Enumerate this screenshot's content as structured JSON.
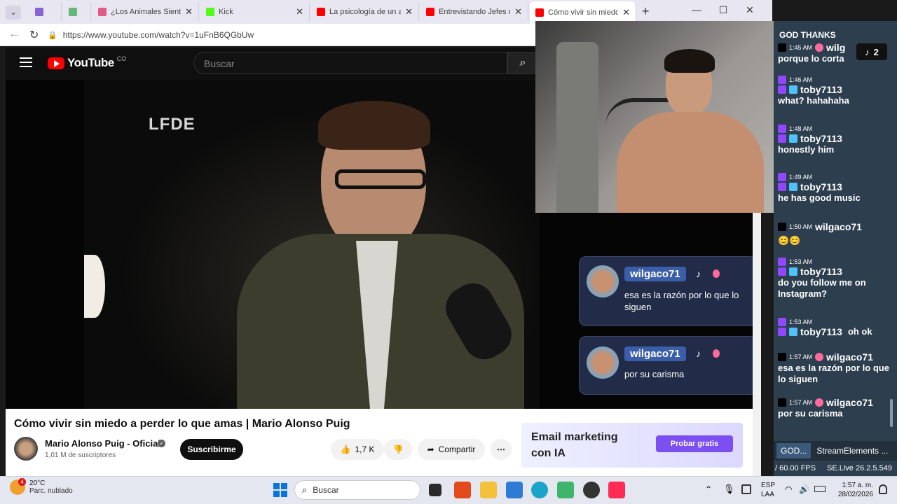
{
  "browser": {
    "tabs": [
      {
        "label": "",
        "color": "#8a63d2"
      },
      {
        "label": "",
        "color": "#64b97a"
      },
      {
        "label": "¿Los Animales Sienten A",
        "color": "#e05a86"
      },
      {
        "label": "Kick",
        "color": "#53fc18"
      },
      {
        "label": "La psicología de un adic",
        "color": "#ff0000"
      },
      {
        "label": "Entrevistando Jefes de N",
        "color": "#ff0000"
      },
      {
        "label": "Cómo vivir sin miedo a p",
        "color": "#ff0000"
      }
    ],
    "url": "https://www.youtube.com/watch?v=1uFnB6QGbUw"
  },
  "youtube": {
    "logo": "YouTube",
    "country": "CO",
    "search_placeholder": "Buscar",
    "video_watermark": "LFDE",
    "title": "Cómo vivir sin miedo a perder lo que amas | Mario Alonso Puig",
    "channel": "Mario Alonso Puig - Oficial",
    "subscribers": "1,01 M de suscriptores",
    "subscribe": "Suscribirme",
    "likes": "1,7 K",
    "share": "Compartir",
    "ad_title_1": "Email marketing",
    "ad_title_2": "con IA",
    "ad_cta": "Probar gratis"
  },
  "overlays": [
    {
      "user": "wilgaco71",
      "text": "esa es la razón por lo que lo siguen"
    },
    {
      "user": "wilgaco71",
      "text": "por su carisma"
    }
  ],
  "chat": {
    "header": "GOD THANKS",
    "tiktok_count": "2",
    "messages": [
      {
        "time": "1:45 AM",
        "user": "wilg",
        "platform": "tiktok",
        "text": "porque lo corta"
      },
      {
        "time": "1:46 AM",
        "user": "toby7113",
        "platform": "twitch",
        "text": "what? hahahaha"
      },
      {
        "time": "1:48 AM",
        "user": "toby7113",
        "platform": "twitch",
        "text": "honestly him"
      },
      {
        "time": "1:49 AM",
        "user": "toby7113",
        "platform": "twitch",
        "text": "he has good music"
      },
      {
        "time": "1:50 AM",
        "user": "wilgaco71",
        "platform": "tiktok",
        "text": "😊😊"
      },
      {
        "time": "1:53 AM",
        "user": "toby7113",
        "platform": "twitch",
        "text": "do you follow me on Instagram?"
      },
      {
        "time": "1:53 AM",
        "user": "toby7113",
        "platform": "twitch",
        "text": "oh ok"
      },
      {
        "time": "1:57 AM",
        "user": "wilgaco71",
        "platform": "tiktok",
        "text": "esa es la razón por lo que lo siguen"
      },
      {
        "time": "1:57 AM",
        "user": "wilgaco71",
        "platform": "tiktok",
        "text": "por su carisma"
      }
    ],
    "tabs": [
      "GOD...",
      "StreamElements ..."
    ],
    "fps": "/ 60.00 FPS",
    "version": "SE.Live 26.2.5.549"
  },
  "taskbar": {
    "temp": "20°C",
    "weather": "Parc. nublado",
    "weather_badge": "4",
    "search": "Buscar",
    "lang1": "ESP",
    "lang2": "LAA",
    "time": "1:57 a. m.",
    "date": "28/02/2026"
  }
}
